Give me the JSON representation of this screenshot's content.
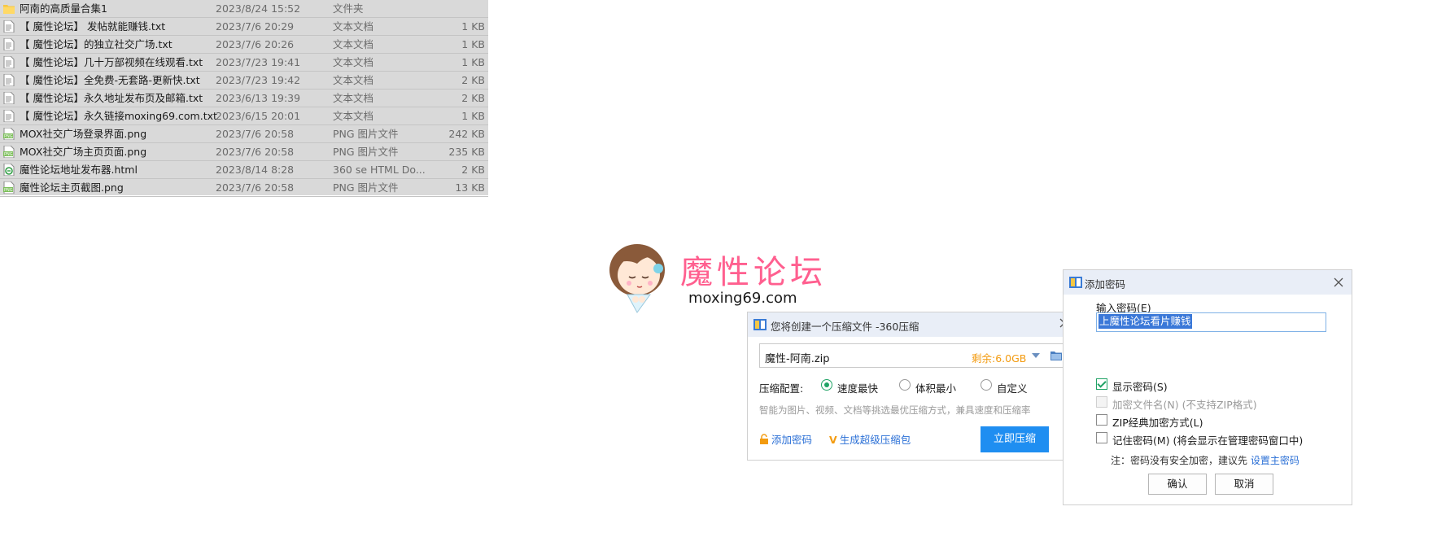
{
  "files": [
    {
      "icon": "folder-icon",
      "name": "阿南的高质量合集1",
      "date": "2023/8/24 15:52",
      "type": "文件夹",
      "size": ""
    },
    {
      "icon": "text-file-icon",
      "name": "【 魔性论坛】 发帖就能赚钱.txt",
      "date": "2023/7/6 20:29",
      "type": "文本文档",
      "size": "1 KB"
    },
    {
      "icon": "text-file-icon",
      "name": "【 魔性论坛】的独立社交广场.txt",
      "date": "2023/7/6 20:26",
      "type": "文本文档",
      "size": "1 KB"
    },
    {
      "icon": "text-file-icon",
      "name": "【 魔性论坛】几十万部视频在线观看.txt",
      "date": "2023/7/23 19:41",
      "type": "文本文档",
      "size": "1 KB"
    },
    {
      "icon": "text-file-icon",
      "name": "【 魔性论坛】全免费-无套路-更新快.txt",
      "date": "2023/7/23 19:42",
      "type": "文本文档",
      "size": "2 KB"
    },
    {
      "icon": "text-file-icon",
      "name": "【 魔性论坛】永久地址发布页及邮箱.txt",
      "date": "2023/6/13 19:39",
      "type": "文本文档",
      "size": "2 KB"
    },
    {
      "icon": "text-file-icon",
      "name": "【 魔性论坛】永久链接moxing69.com.txt",
      "date": "2023/6/15 20:01",
      "type": "文本文档",
      "size": "1 KB"
    },
    {
      "icon": "png-file-icon",
      "name": "MOX社交广场登录界面.png",
      "date": "2023/7/6 20:58",
      "type": "PNG 图片文件",
      "size": "242 KB"
    },
    {
      "icon": "png-file-icon",
      "name": "MOX社交广场主页页面.png",
      "date": "2023/7/6 20:58",
      "type": "PNG 图片文件",
      "size": "235 KB"
    },
    {
      "icon": "html-file-icon",
      "name": "魔性论坛地址发布器.html",
      "date": "2023/8/14 8:28",
      "type": "360 se HTML Do...",
      "size": "2 KB"
    },
    {
      "icon": "png-file-icon",
      "name": "魔性论坛主页截图.png",
      "date": "2023/7/6 20:58",
      "type": "PNG 图片文件",
      "size": "13 KB"
    }
  ],
  "logo": {
    "title": "魔性论坛",
    "url": "moxing69.com"
  },
  "compress_dialog": {
    "title": "您将创建一个压缩文件 -360压缩",
    "filename": "魔性-阿南.zip",
    "free_space": "剩余:6.0GB",
    "config_label": "压缩配置:",
    "options": [
      "速度最快",
      "体积最小",
      "自定义"
    ],
    "selected_option": "速度最快",
    "hint": "智能为图片、视频、文档等挑选最优压缩方式，兼具速度和压缩率",
    "add_password": "添加密码",
    "super_zip": "生成超级压缩包",
    "compress_button": "立即压缩"
  },
  "password_dialog": {
    "title": "添加密码",
    "input_label": "输入密码(E)",
    "password_value": "上魔性论坛看片赚钱",
    "checkboxes": [
      {
        "label": "显示密码(S)",
        "checked": true,
        "disabled": false
      },
      {
        "label": "加密文件名(N) (不支持ZIP格式)",
        "checked": false,
        "disabled": true
      },
      {
        "label": "ZIP经典加密方式(L)",
        "checked": false,
        "disabled": false
      },
      {
        "label": "记住密码(M) (将会显示在管理密码窗口中)",
        "checked": false,
        "disabled": false
      }
    ],
    "note_prefix": "注：密码没有安全加密，建议先 ",
    "note_link": "设置主密码",
    "ok_button": "确认",
    "cancel_button": "取消"
  },
  "colors": {
    "accent_blue": "#1f8ef1",
    "free_space_orange": "#f39b10",
    "logo_pink": "#ff5f8f",
    "check_green": "#21a366"
  }
}
